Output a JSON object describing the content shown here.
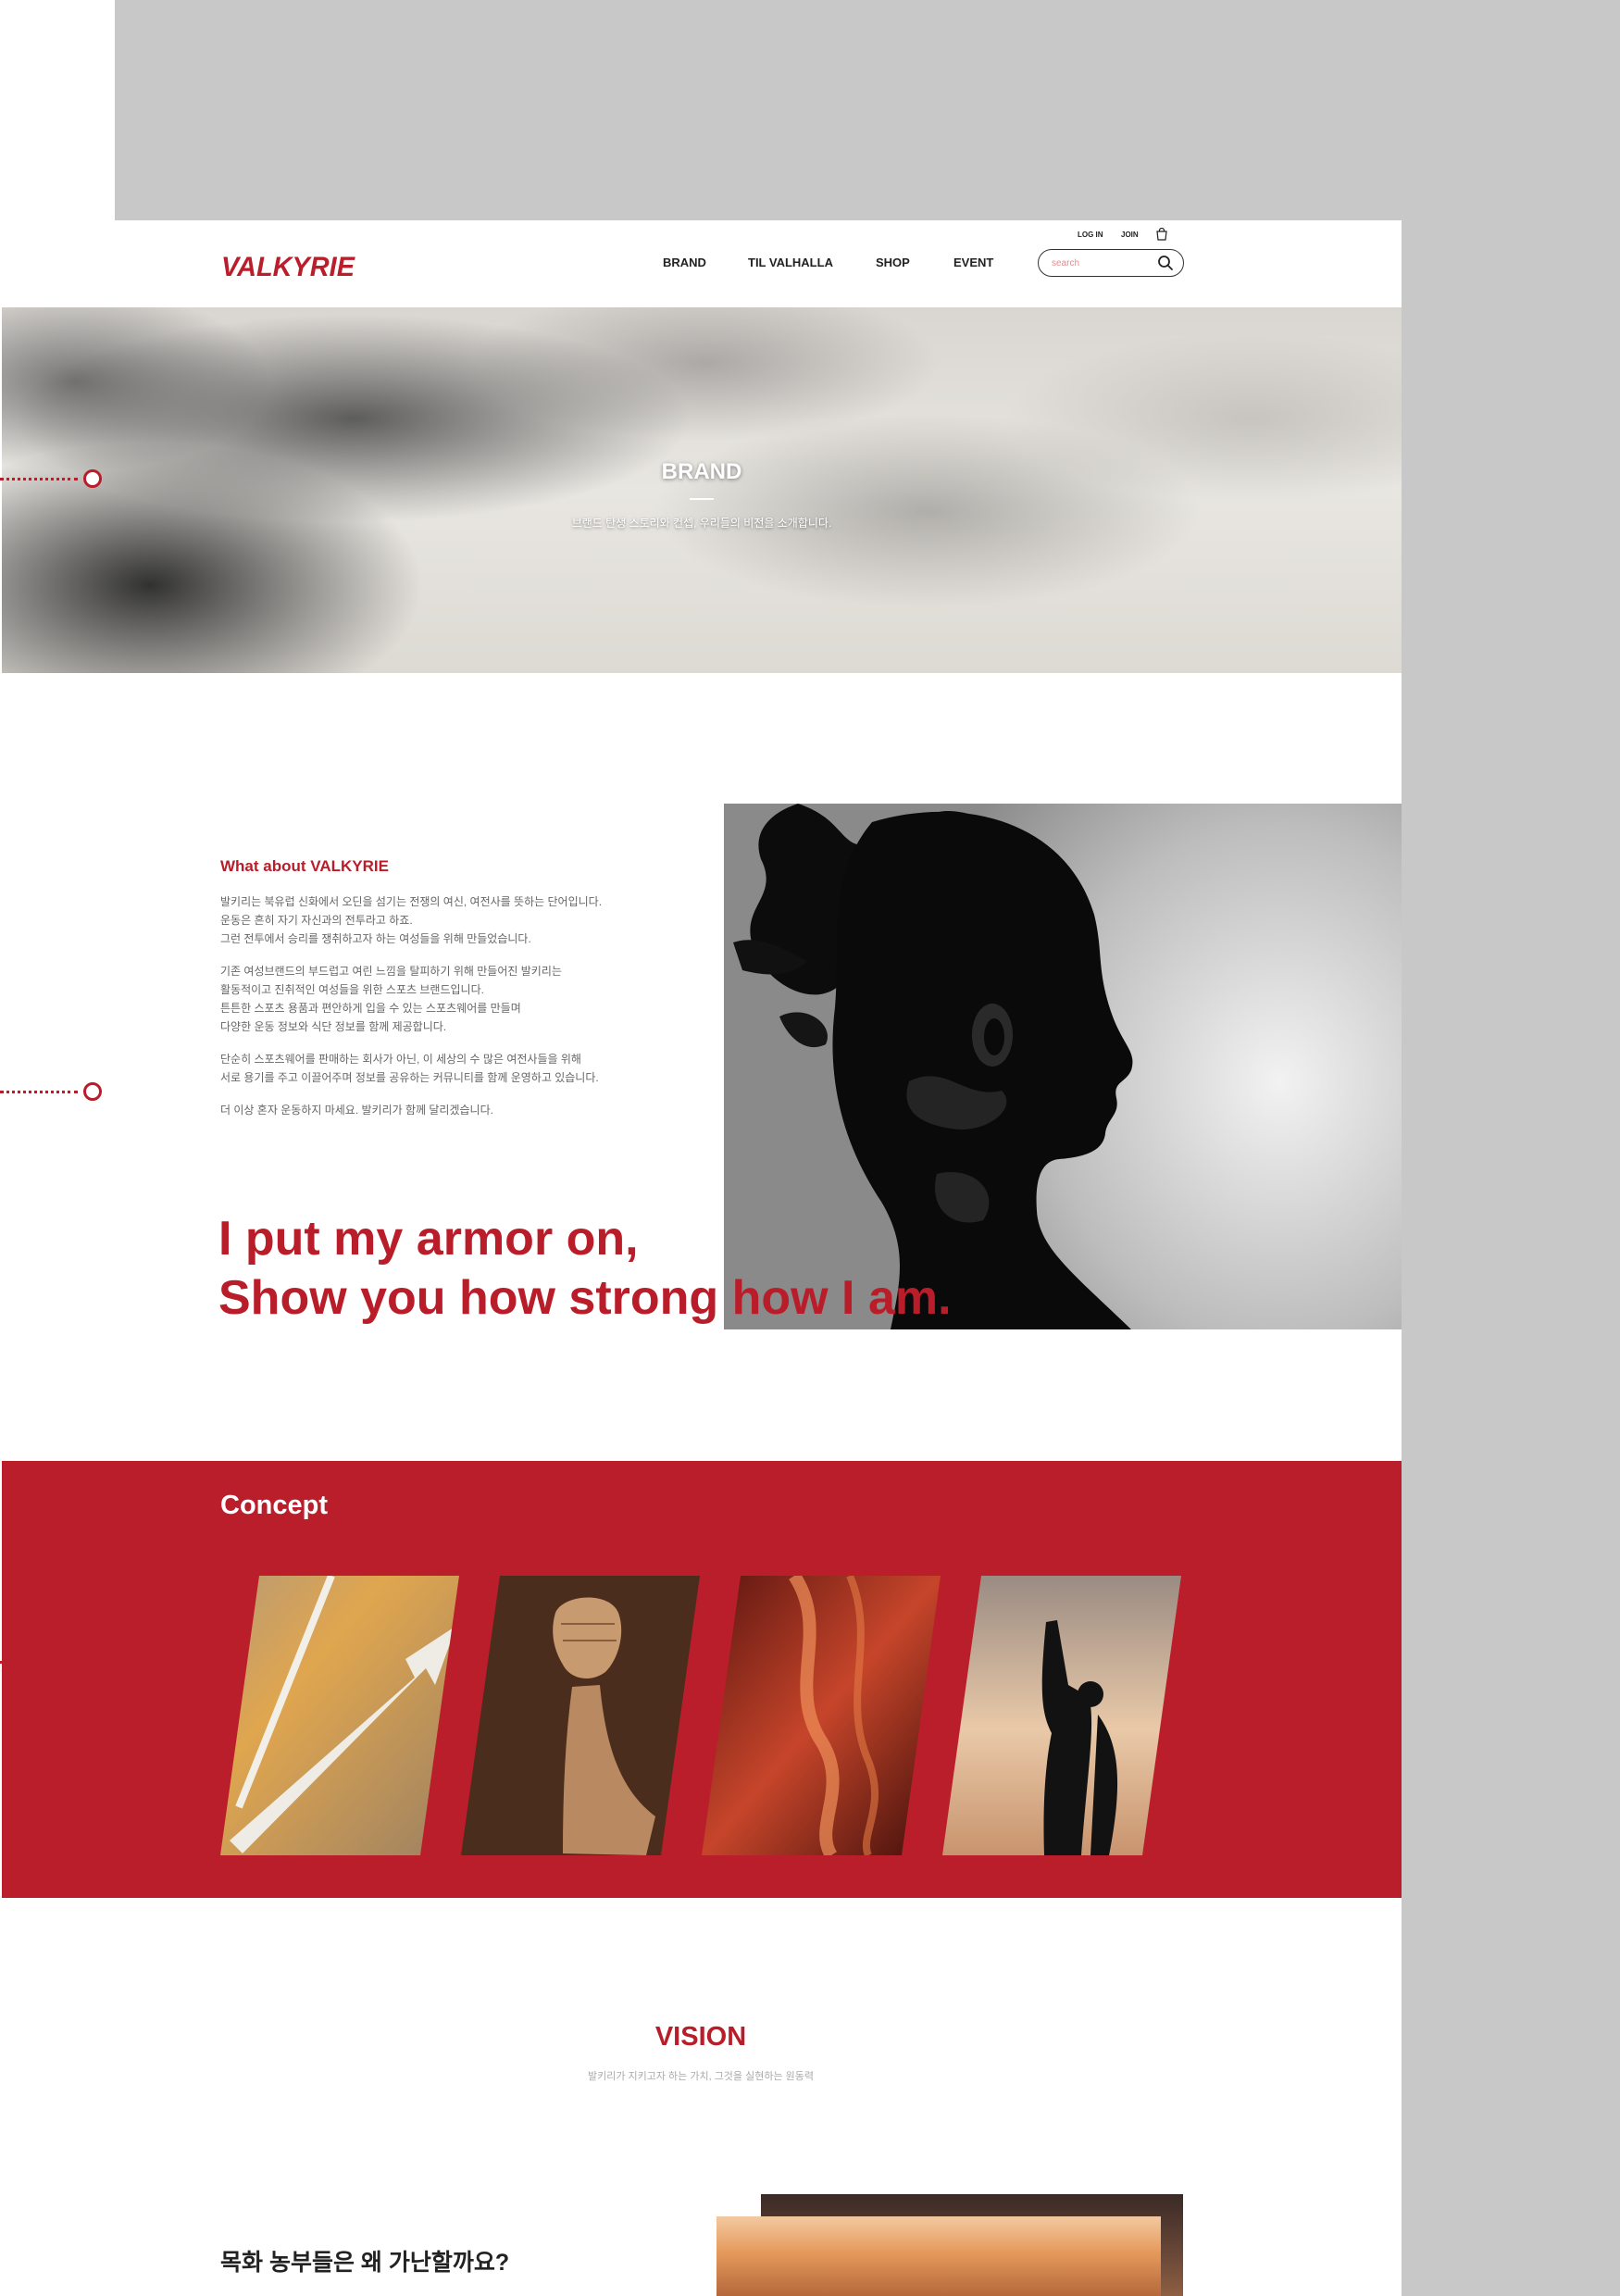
{
  "header": {
    "logo_text": "VALKYRIE",
    "nav": [
      {
        "label": "BRAND"
      },
      {
        "label": "TIL VALHALLA"
      },
      {
        "label": "SHOP"
      },
      {
        "label": "EVENT"
      }
    ],
    "login_label": "LOG IN",
    "join_label": "JOIN",
    "search_placeholder": "search",
    "search_value": ""
  },
  "hero": {
    "title": "BRAND",
    "subtitle": "브랜드 탄생 스토리와 컨셉, 우리들의 비전을 소개합니다."
  },
  "about": {
    "title": "What about VALKYRIE",
    "paragraphs": [
      "발키리는 북유럽 신화에서 오딘을 섬기는 전쟁의 여신, 여전사를 뜻하는 단어입니다.\n운동은 흔히 자기 자신과의 전투라고 하죠.\n그런 전투에서 승리를 쟁취하고자 하는 여성들을 위해 만들었습니다.",
      "기존 여성브랜드의 부드럽고 여린 느낌을 탈피하기 위해 만들어진 발키리는\n활동적이고 진취적인 여성들을 위한 스포츠 브랜드입니다.\n튼튼한 스포츠 용품과 편안하게 입을 수 있는 스포츠웨어를 만들며\n다양한 운동 정보와 식단 정보를 함께 제공합니다.",
      "단순히 스포츠웨어를 판매하는 회사가 아닌, 이 세상의 수 많은 여전사들을 위해\n서로 용기를 주고 이끌어주며 정보를 공유하는 커뮤니티를 함께 운영하고 있습니다.",
      "더 이상 혼자 운동하지 마세요. 발키리가 함께 달리겠습니다."
    ],
    "slogan_line1": "I put my armor on,",
    "slogan_line2": "Show you how strong how I am."
  },
  "concept": {
    "title": "Concept"
  },
  "vision": {
    "title": "VISION",
    "subtitle": "발키리가 지키고자 하는 가치, 그것을 실현하는 원동력",
    "question": "목화 농부들은 왜 가난할까요?"
  },
  "colors": {
    "brand_red": "#bb1e2b",
    "frame_grey": "#c8c8c8"
  }
}
